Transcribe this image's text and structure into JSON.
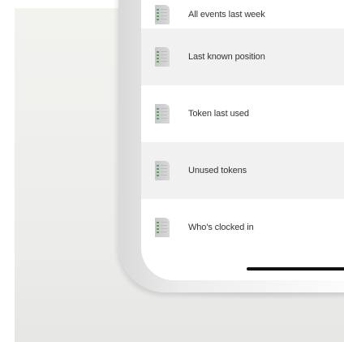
{
  "menu": {
    "items": [
      {
        "label": "All events last week",
        "icon": "document-list-icon"
      },
      {
        "label": "Last known position",
        "icon": "document-list-icon"
      },
      {
        "label": "Token last used",
        "icon": "document-list-icon"
      },
      {
        "label": "Unused tokens",
        "icon": "document-list-icon"
      },
      {
        "label": "Who's clocked in",
        "icon": "document-list-icon"
      }
    ]
  },
  "colors": {
    "icon_accent": "#4fb04a",
    "row_shade": "#f1f1f1",
    "text": "#333333"
  }
}
